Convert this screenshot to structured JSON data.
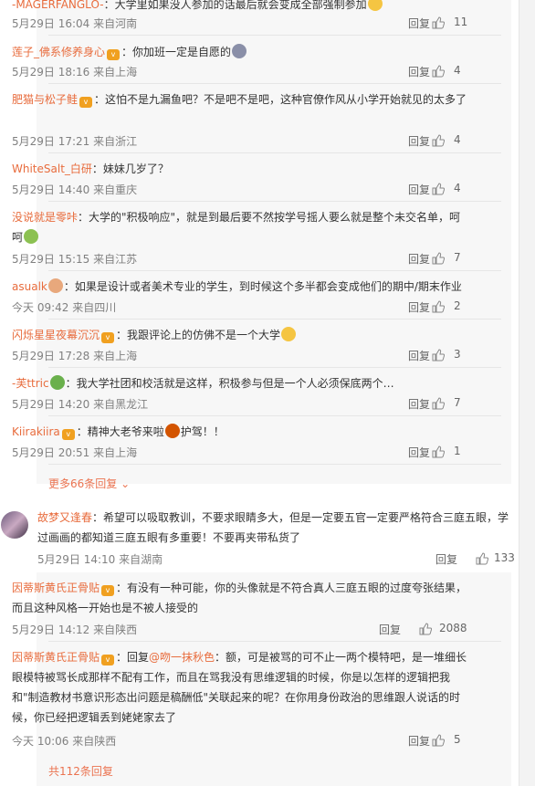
{
  "reply_label": "回复",
  "more_replies": "更多66条回复",
  "total_replies": "共112条回复",
  "replies_top": [
    {
      "user": "-MAGERFANGLO-",
      "text": "：大学里如果没人参加的话最后就会变成全部强制参加",
      "time": "5月29日 16:04 来自河南",
      "likes": "11"
    },
    {
      "user": "莲子_佛系修养身心",
      "text": "：你加班一定是自愿的",
      "time": "5月29日 18:16 来自上海",
      "likes": "4"
    },
    {
      "user": "肥猫与松子鲑",
      "text": "：这怕不是九漏鱼吧？不是吧不是吧，这种官僚作风从小学开始就见的太多了",
      "time": "5月29日 17:21 来自浙江",
      "likes": "4"
    },
    {
      "user": "WhiteSalt_白研",
      "text": "：妹妹几岁了？",
      "time": "5月29日 14:40 来自重庆",
      "likes": "4"
    },
    {
      "user": "没说就是零咔",
      "text": "：大学的\"积极响应\"，就是到最后要不然按学号摇人要么就是整个未交名单，呵呵",
      "time": "5月29日 15:15 来自江苏",
      "likes": "7"
    },
    {
      "user": "asualk",
      "text": "：如果是设计或者美术专业的学生，到时候这个多半都会变成他们的期中/期末作业",
      "time": "今天 09:42 来自四川",
      "likes": "2"
    },
    {
      "user": "闪烁星星夜幕沉沉",
      "text": "：我跟评论上的仿佛不是一个大学",
      "time": "5月29日 17:28 来自上海",
      "likes": "3"
    },
    {
      "user": "-芙ttric",
      "text": "：我大学社团和校活就是这样，积极参与但是一个人必须保底两个…",
      "time": "5月29日 14:20 来自黑龙江",
      "likes": "7"
    },
    {
      "user": "Kiirakiira",
      "text": "：精神大老爷来啦",
      "text2": "护驾！！",
      "time": "5月29日 20:51 来自上海",
      "likes": "1"
    }
  ],
  "top_comment": {
    "user": "故梦又逢春",
    "text": "：希望可以吸取教训，不要求眼睛多大，但是一定要五官一定要严格符合三庭五眼，学过画画的都知道三庭五眼有多重要！不要再夹带私货了",
    "time": "5月29日 14:10 来自湖南",
    "likes": "133"
  },
  "replies_bottom": [
    {
      "user": "因蒂斯黄氏正骨贴",
      "text": "：有没有一种可能，你的头像就是不符合真人三庭五眼的过度夸张结果，而且这种风格一开始也是不被人接受的",
      "time": "5月29日 14:12 来自陕西",
      "likes": "2088"
    },
    {
      "user": "因蒂斯黄氏正骨贴",
      "text_pre": "：回复",
      "mention": "@吻一抹秋色",
      "text": "：额，可是被骂的可不止一两个模特吧，是一堆细长眼模特被骂长成那样不配有工作，而且在骂我没有思维逻辑的时候，你是以怎样的逻辑把我和\"制造教材书意识形态出问题是稿酬低\"关联起来的呢？在你用身份政治的思维跟人说话的时候，你已经把逻辑丢到姥姥家去了",
      "time": "今天 10:06 来自陕西",
      "likes": "5"
    }
  ],
  "colors": {
    "link": "#eb7350",
    "meta": "#808080",
    "reply_bg": "#f7f7f7"
  }
}
